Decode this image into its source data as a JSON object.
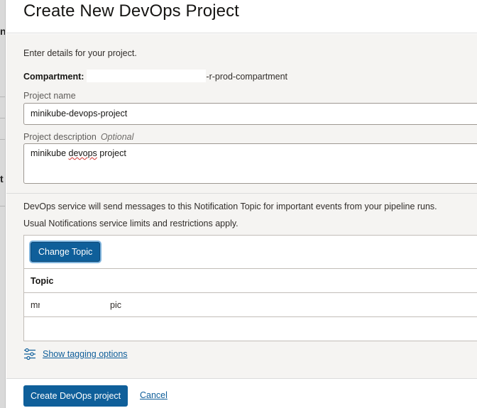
{
  "backdrop": {
    "fragments": [
      "n",
      "t"
    ]
  },
  "dialog": {
    "title": "Create New DevOps Project",
    "intro": "Enter details for your project.",
    "compartment": {
      "label": "Compartment:",
      "value": "-r-prod-compartment"
    },
    "project_name": {
      "label": "Project name",
      "value": "minikube-devops-project"
    },
    "project_description": {
      "label": "Project description",
      "optional": "Optional",
      "value_before": "minikube ",
      "value_misspelled": "devops",
      "value_after": " project"
    },
    "notification": {
      "line1": "DevOps service will send messages to this Notification Topic for important events from your pipeline runs.",
      "line2": "Usual Notifications service limits and restrictions apply.",
      "change_button": "Change Topic",
      "column_header": "Topic",
      "row_prefix": "mr",
      "row_suffix": "pic"
    },
    "tagging_link": "Show tagging options",
    "footer": {
      "primary": "Create DevOps project",
      "cancel": "Cancel"
    }
  },
  "colors": {
    "primary": "#0f5f9a",
    "link": "#0e5d99",
    "body_background": "#f5f4f2"
  },
  "icons": {
    "tagging": "sliders-icon"
  }
}
